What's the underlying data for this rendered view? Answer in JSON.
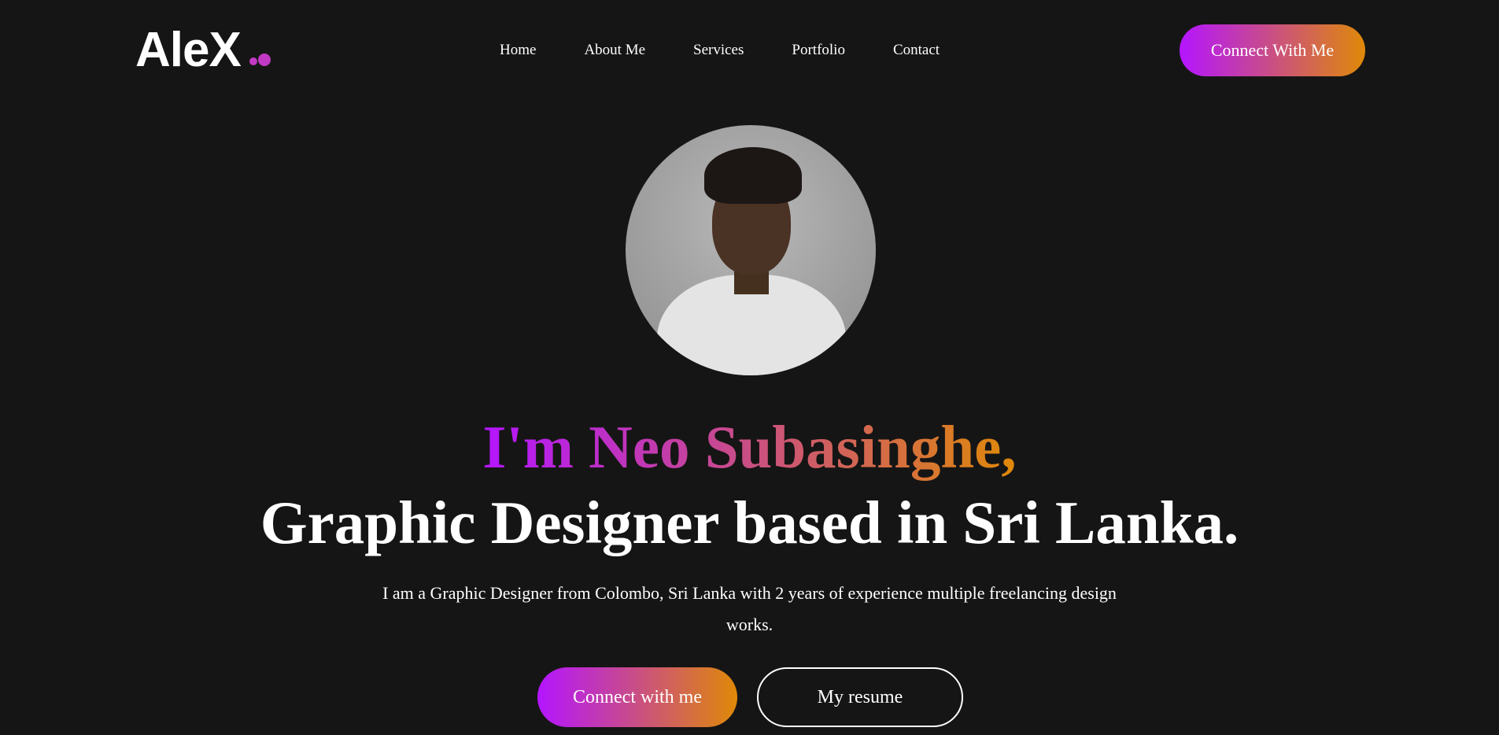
{
  "logo": {
    "text": "AleX"
  },
  "nav": {
    "items": [
      {
        "label": "Home"
      },
      {
        "label": "About Me"
      },
      {
        "label": "Services"
      },
      {
        "label": "Portfolio"
      },
      {
        "label": "Contact"
      }
    ],
    "connect_label": "Connect With Me"
  },
  "hero": {
    "headline_name": "I'm Neo Subasinghe,",
    "headline_role": "Graphic Designer based in Sri Lanka.",
    "description": "I am a Graphic Designer from Colombo, Sri Lanka with 2 years of experience multiple freelancing design works.",
    "connect_label": "Connect with me",
    "resume_label": "My resume"
  },
  "colors": {
    "background": "#161515",
    "gradient_start": "#b415ff",
    "gradient_end": "#df8908",
    "text": "#ffffff"
  }
}
